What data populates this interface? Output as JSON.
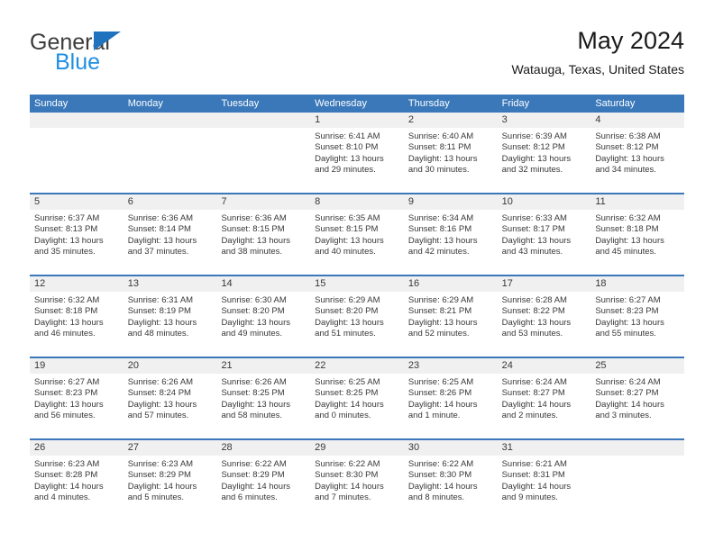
{
  "brand": {
    "name_top": "General",
    "name_bottom": "Blue",
    "triangle_icon": "triangle-icon",
    "colors": {
      "general": "#3c3c3c",
      "blue": "#1f8fe0",
      "triangle": "#1f72bd"
    }
  },
  "header": {
    "title": "May 2024",
    "subtitle": "Watauga, Texas, United States"
  },
  "theme": {
    "header_blue": "#3a78ba",
    "daynum_band": "#f0f0f0",
    "text": "#38383a"
  },
  "weekdays": [
    "Sunday",
    "Monday",
    "Tuesday",
    "Wednesday",
    "Thursday",
    "Friday",
    "Saturday"
  ],
  "weeks": [
    {
      "days": [
        {
          "num": "",
          "lines": []
        },
        {
          "num": "",
          "lines": []
        },
        {
          "num": "",
          "lines": []
        },
        {
          "num": "1",
          "lines": [
            "Sunrise: 6:41 AM",
            "Sunset: 8:10 PM",
            "Daylight: 13 hours",
            "and 29 minutes."
          ]
        },
        {
          "num": "2",
          "lines": [
            "Sunrise: 6:40 AM",
            "Sunset: 8:11 PM",
            "Daylight: 13 hours",
            "and 30 minutes."
          ]
        },
        {
          "num": "3",
          "lines": [
            "Sunrise: 6:39 AM",
            "Sunset: 8:12 PM",
            "Daylight: 13 hours",
            "and 32 minutes."
          ]
        },
        {
          "num": "4",
          "lines": [
            "Sunrise: 6:38 AM",
            "Sunset: 8:12 PM",
            "Daylight: 13 hours",
            "and 34 minutes."
          ]
        }
      ]
    },
    {
      "days": [
        {
          "num": "5",
          "lines": [
            "Sunrise: 6:37 AM",
            "Sunset: 8:13 PM",
            "Daylight: 13 hours",
            "and 35 minutes."
          ]
        },
        {
          "num": "6",
          "lines": [
            "Sunrise: 6:36 AM",
            "Sunset: 8:14 PM",
            "Daylight: 13 hours",
            "and 37 minutes."
          ]
        },
        {
          "num": "7",
          "lines": [
            "Sunrise: 6:36 AM",
            "Sunset: 8:15 PM",
            "Daylight: 13 hours",
            "and 38 minutes."
          ]
        },
        {
          "num": "8",
          "lines": [
            "Sunrise: 6:35 AM",
            "Sunset: 8:15 PM",
            "Daylight: 13 hours",
            "and 40 minutes."
          ]
        },
        {
          "num": "9",
          "lines": [
            "Sunrise: 6:34 AM",
            "Sunset: 8:16 PM",
            "Daylight: 13 hours",
            "and 42 minutes."
          ]
        },
        {
          "num": "10",
          "lines": [
            "Sunrise: 6:33 AM",
            "Sunset: 8:17 PM",
            "Daylight: 13 hours",
            "and 43 minutes."
          ]
        },
        {
          "num": "11",
          "lines": [
            "Sunrise: 6:32 AM",
            "Sunset: 8:18 PM",
            "Daylight: 13 hours",
            "and 45 minutes."
          ]
        }
      ]
    },
    {
      "days": [
        {
          "num": "12",
          "lines": [
            "Sunrise: 6:32 AM",
            "Sunset: 8:18 PM",
            "Daylight: 13 hours",
            "and 46 minutes."
          ]
        },
        {
          "num": "13",
          "lines": [
            "Sunrise: 6:31 AM",
            "Sunset: 8:19 PM",
            "Daylight: 13 hours",
            "and 48 minutes."
          ]
        },
        {
          "num": "14",
          "lines": [
            "Sunrise: 6:30 AM",
            "Sunset: 8:20 PM",
            "Daylight: 13 hours",
            "and 49 minutes."
          ]
        },
        {
          "num": "15",
          "lines": [
            "Sunrise: 6:29 AM",
            "Sunset: 8:20 PM",
            "Daylight: 13 hours",
            "and 51 minutes."
          ]
        },
        {
          "num": "16",
          "lines": [
            "Sunrise: 6:29 AM",
            "Sunset: 8:21 PM",
            "Daylight: 13 hours",
            "and 52 minutes."
          ]
        },
        {
          "num": "17",
          "lines": [
            "Sunrise: 6:28 AM",
            "Sunset: 8:22 PM",
            "Daylight: 13 hours",
            "and 53 minutes."
          ]
        },
        {
          "num": "18",
          "lines": [
            "Sunrise: 6:27 AM",
            "Sunset: 8:23 PM",
            "Daylight: 13 hours",
            "and 55 minutes."
          ]
        }
      ]
    },
    {
      "days": [
        {
          "num": "19",
          "lines": [
            "Sunrise: 6:27 AM",
            "Sunset: 8:23 PM",
            "Daylight: 13 hours",
            "and 56 minutes."
          ]
        },
        {
          "num": "20",
          "lines": [
            "Sunrise: 6:26 AM",
            "Sunset: 8:24 PM",
            "Daylight: 13 hours",
            "and 57 minutes."
          ]
        },
        {
          "num": "21",
          "lines": [
            "Sunrise: 6:26 AM",
            "Sunset: 8:25 PM",
            "Daylight: 13 hours",
            "and 58 minutes."
          ]
        },
        {
          "num": "22",
          "lines": [
            "Sunrise: 6:25 AM",
            "Sunset: 8:25 PM",
            "Daylight: 14 hours",
            "and 0 minutes."
          ]
        },
        {
          "num": "23",
          "lines": [
            "Sunrise: 6:25 AM",
            "Sunset: 8:26 PM",
            "Daylight: 14 hours",
            "and 1 minute."
          ]
        },
        {
          "num": "24",
          "lines": [
            "Sunrise: 6:24 AM",
            "Sunset: 8:27 PM",
            "Daylight: 14 hours",
            "and 2 minutes."
          ]
        },
        {
          "num": "25",
          "lines": [
            "Sunrise: 6:24 AM",
            "Sunset: 8:27 PM",
            "Daylight: 14 hours",
            "and 3 minutes."
          ]
        }
      ]
    },
    {
      "days": [
        {
          "num": "26",
          "lines": [
            "Sunrise: 6:23 AM",
            "Sunset: 8:28 PM",
            "Daylight: 14 hours",
            "and 4 minutes."
          ]
        },
        {
          "num": "27",
          "lines": [
            "Sunrise: 6:23 AM",
            "Sunset: 8:29 PM",
            "Daylight: 14 hours",
            "and 5 minutes."
          ]
        },
        {
          "num": "28",
          "lines": [
            "Sunrise: 6:22 AM",
            "Sunset: 8:29 PM",
            "Daylight: 14 hours",
            "and 6 minutes."
          ]
        },
        {
          "num": "29",
          "lines": [
            "Sunrise: 6:22 AM",
            "Sunset: 8:30 PM",
            "Daylight: 14 hours",
            "and 7 minutes."
          ]
        },
        {
          "num": "30",
          "lines": [
            "Sunrise: 6:22 AM",
            "Sunset: 8:30 PM",
            "Daylight: 14 hours",
            "and 8 minutes."
          ]
        },
        {
          "num": "31",
          "lines": [
            "Sunrise: 6:21 AM",
            "Sunset: 8:31 PM",
            "Daylight: 14 hours",
            "and 9 minutes."
          ]
        },
        {
          "num": "",
          "lines": []
        }
      ]
    }
  ]
}
